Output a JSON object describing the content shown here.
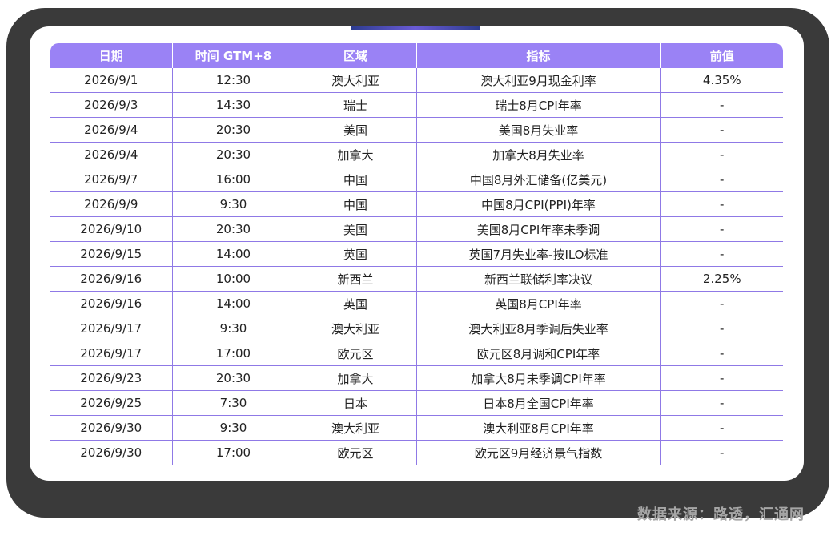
{
  "table": {
    "headers": [
      "日期",
      "时间 GTM+8",
      "区域",
      "指标",
      "前值"
    ],
    "rows": [
      [
        "2026/9/1",
        "12:30",
        "澳大利亚",
        "澳大利亚9月现金利率",
        "4.35%"
      ],
      [
        "2026/9/3",
        "14:30",
        "瑞士",
        "瑞士8月CPI年率",
        "-"
      ],
      [
        "2026/9/4",
        "20:30",
        "美国",
        "美国8月失业率",
        "-"
      ],
      [
        "2026/9/4",
        "20:30",
        "加拿大",
        "加拿大8月失业率",
        "-"
      ],
      [
        "2026/9/7",
        "16:00",
        "中国",
        "中国8月外汇储备(亿美元)",
        "-"
      ],
      [
        "2026/9/9",
        "9:30",
        "中国",
        "中国8月CPI(PPI)年率",
        "-"
      ],
      [
        "2026/9/10",
        "20:30",
        "美国",
        "美国8月CPI年率未季调",
        "-"
      ],
      [
        "2026/9/15",
        "14:00",
        "英国",
        "英国7月失业率-按ILO标准",
        "-"
      ],
      [
        "2026/9/16",
        "10:00",
        "新西兰",
        "新西兰联储利率决议",
        "2.25%"
      ],
      [
        "2026/9/16",
        "14:00",
        "英国",
        "英国8月CPI年率",
        "-"
      ],
      [
        "2026/9/17",
        "9:30",
        "澳大利亚",
        "澳大利亚8月季调后失业率",
        "-"
      ],
      [
        "2026/9/17",
        "17:00",
        "欧元区",
        "欧元区8月调和CPI年率",
        "-"
      ],
      [
        "2026/9/23",
        "20:30",
        "加拿大",
        "加拿大8月未季调CPI年率",
        "-"
      ],
      [
        "2026/9/25",
        "7:30",
        "日本",
        "日本8月全国CPI年率",
        "-"
      ],
      [
        "2026/9/30",
        "9:30",
        "澳大利亚",
        "澳大利亚8月CPI年率",
        "-"
      ],
      [
        "2026/9/30",
        "17:00",
        "欧元区",
        "欧元区9月经济景气指数",
        "-"
      ]
    ]
  },
  "source_note": "数据来源：路透，汇通网",
  "colors": {
    "header_bg": "#9a82f5",
    "grid_line": "#8f79e6",
    "frame": "#3a3a3a",
    "source_text": "#a6a6a6"
  }
}
